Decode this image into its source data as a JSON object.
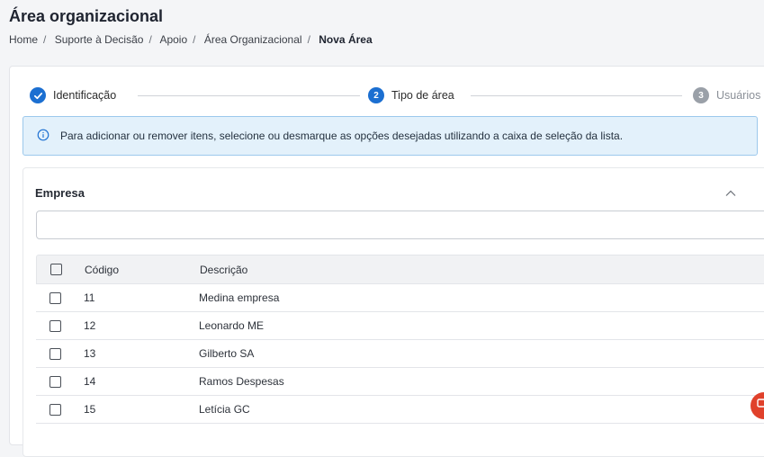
{
  "page": {
    "title": "Área organizacional",
    "breadcrumb": [
      "Home",
      "Suporte à Decisão",
      "Apoio",
      "Área Organizacional"
    ],
    "breadcrumb_current": "Nova Área"
  },
  "stepper": {
    "steps": [
      {
        "number": "",
        "label": "Identificação",
        "state": "done"
      },
      {
        "number": "2",
        "label": "Tipo de área",
        "state": "active"
      },
      {
        "number": "3",
        "label": "Usuários",
        "state": "pending"
      }
    ]
  },
  "info": {
    "message": "Para adicionar ou remover itens, selecione ou desmarque as opções desejadas utilizando a caixa de seleção da lista."
  },
  "section": {
    "title": "Empresa",
    "search_value": "",
    "columns": {
      "code": "Código",
      "description": "Descrição"
    },
    "rows": [
      {
        "code": "11",
        "description": "Medina empresa"
      },
      {
        "code": "12",
        "description": "Leonardo ME"
      },
      {
        "code": "13",
        "description": "Gilberto SA"
      },
      {
        "code": "14",
        "description": "Ramos Despesas"
      },
      {
        "code": "15",
        "description": "Letícia GC"
      }
    ]
  },
  "colors": {
    "primary": "#1b6fd1",
    "info_bg": "#e3f1fb",
    "fab": "#e0412b"
  }
}
